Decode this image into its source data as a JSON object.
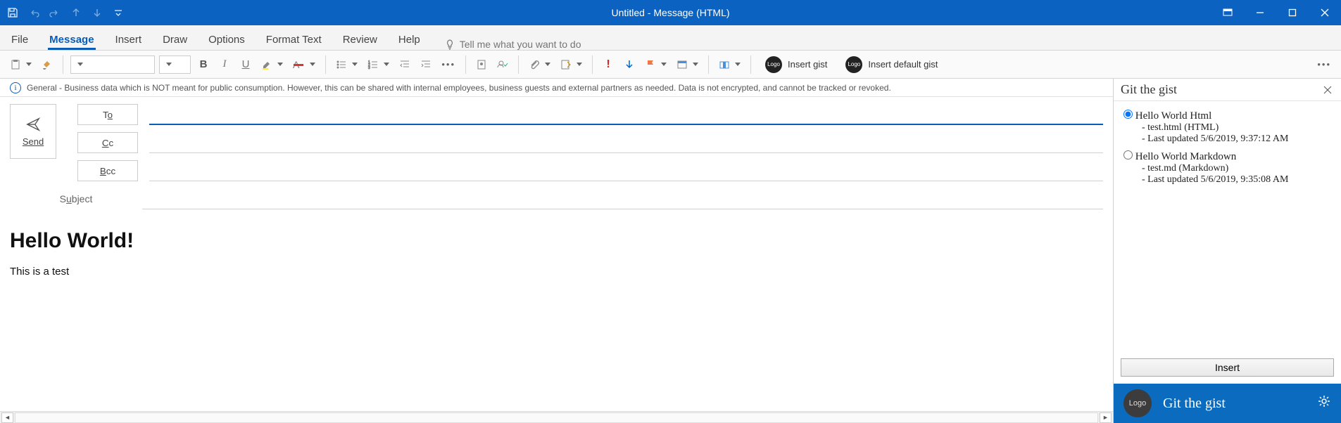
{
  "titlebar": {
    "title": "Untitled  -  Message (HTML)"
  },
  "qat": {
    "save": "save",
    "undo": "undo",
    "redo": "redo",
    "up": "up",
    "down": "down",
    "more": "more"
  },
  "tabs": {
    "file": "File",
    "message": "Message",
    "insert": "Insert",
    "draw": "Draw",
    "options": "Options",
    "format": "Format Text",
    "review": "Review",
    "help": "Help",
    "tellme_placeholder": "Tell me what you want to do"
  },
  "ribbon": {
    "font_name": "",
    "font_size": "",
    "insert_gist": "Insert gist",
    "insert_default_gist": "Insert default gist"
  },
  "infobar": {
    "text": "General - Business data which is NOT meant for public consumption. However, this can be shared with internal employees, business guests and external partners as needed. Data is not encrypted, and cannot be tracked or revoked."
  },
  "compose": {
    "send": "Send",
    "to": "To",
    "cc": "Cc",
    "bcc": "Bcc",
    "subject_label": "Subject",
    "to_value": "",
    "cc_value": "",
    "bcc_value": "",
    "subject_value": "",
    "body_heading": "Hello World!",
    "body_text": "This is a test"
  },
  "pane": {
    "title": "Git the gist",
    "gists": [
      {
        "name": "Hello World Html",
        "file": "test.html (HTML)",
        "updated": "Last updated 5/6/2019, 9:37:12 AM",
        "selected": true
      },
      {
        "name": "Hello World Markdown",
        "file": "test.md (Markdown)",
        "updated": "Last updated 5/6/2019, 9:35:08 AM",
        "selected": false
      }
    ],
    "insert": "Insert",
    "footer_title": "Git the gist",
    "footer_logo": "Logo"
  }
}
